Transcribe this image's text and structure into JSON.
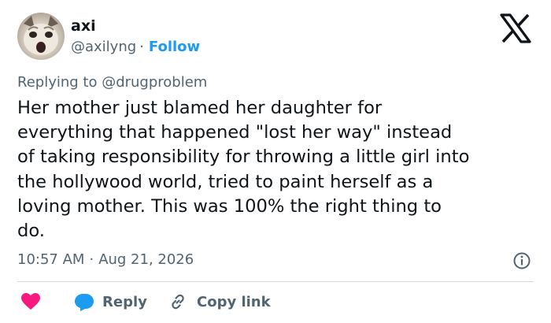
{
  "author": {
    "name": "axi",
    "handle": "@axilyng",
    "separator": "·",
    "follow_label": "Follow"
  },
  "reply_context": {
    "text": "Replying to @drugproblem"
  },
  "tweet": {
    "lines": [
      "Her mother just blamed her daughter for",
      "everything that happened \"lost her way\" instead",
      "of taking responsibility for throwing a little girl into",
      "the hollywood world, tried to paint herself as a",
      "loving mother. This was 100% the right thing to",
      "do."
    ],
    "time": "10:57 AM",
    "separator": "·",
    "date": "Aug 21, 2026"
  },
  "actions": {
    "reply_label": "Reply",
    "copy_link_label": "Copy link"
  },
  "icons": {
    "logo": "x-logo-icon",
    "info": "info-icon",
    "like": "heart-icon",
    "reply": "reply-bubble-icon",
    "copy": "link-icon"
  },
  "colors": {
    "accent": "#1d9bf0",
    "like": "#f91880",
    "secondary_text": "#536471",
    "primary_text": "#0f1419",
    "divider": "#cfd9de"
  }
}
